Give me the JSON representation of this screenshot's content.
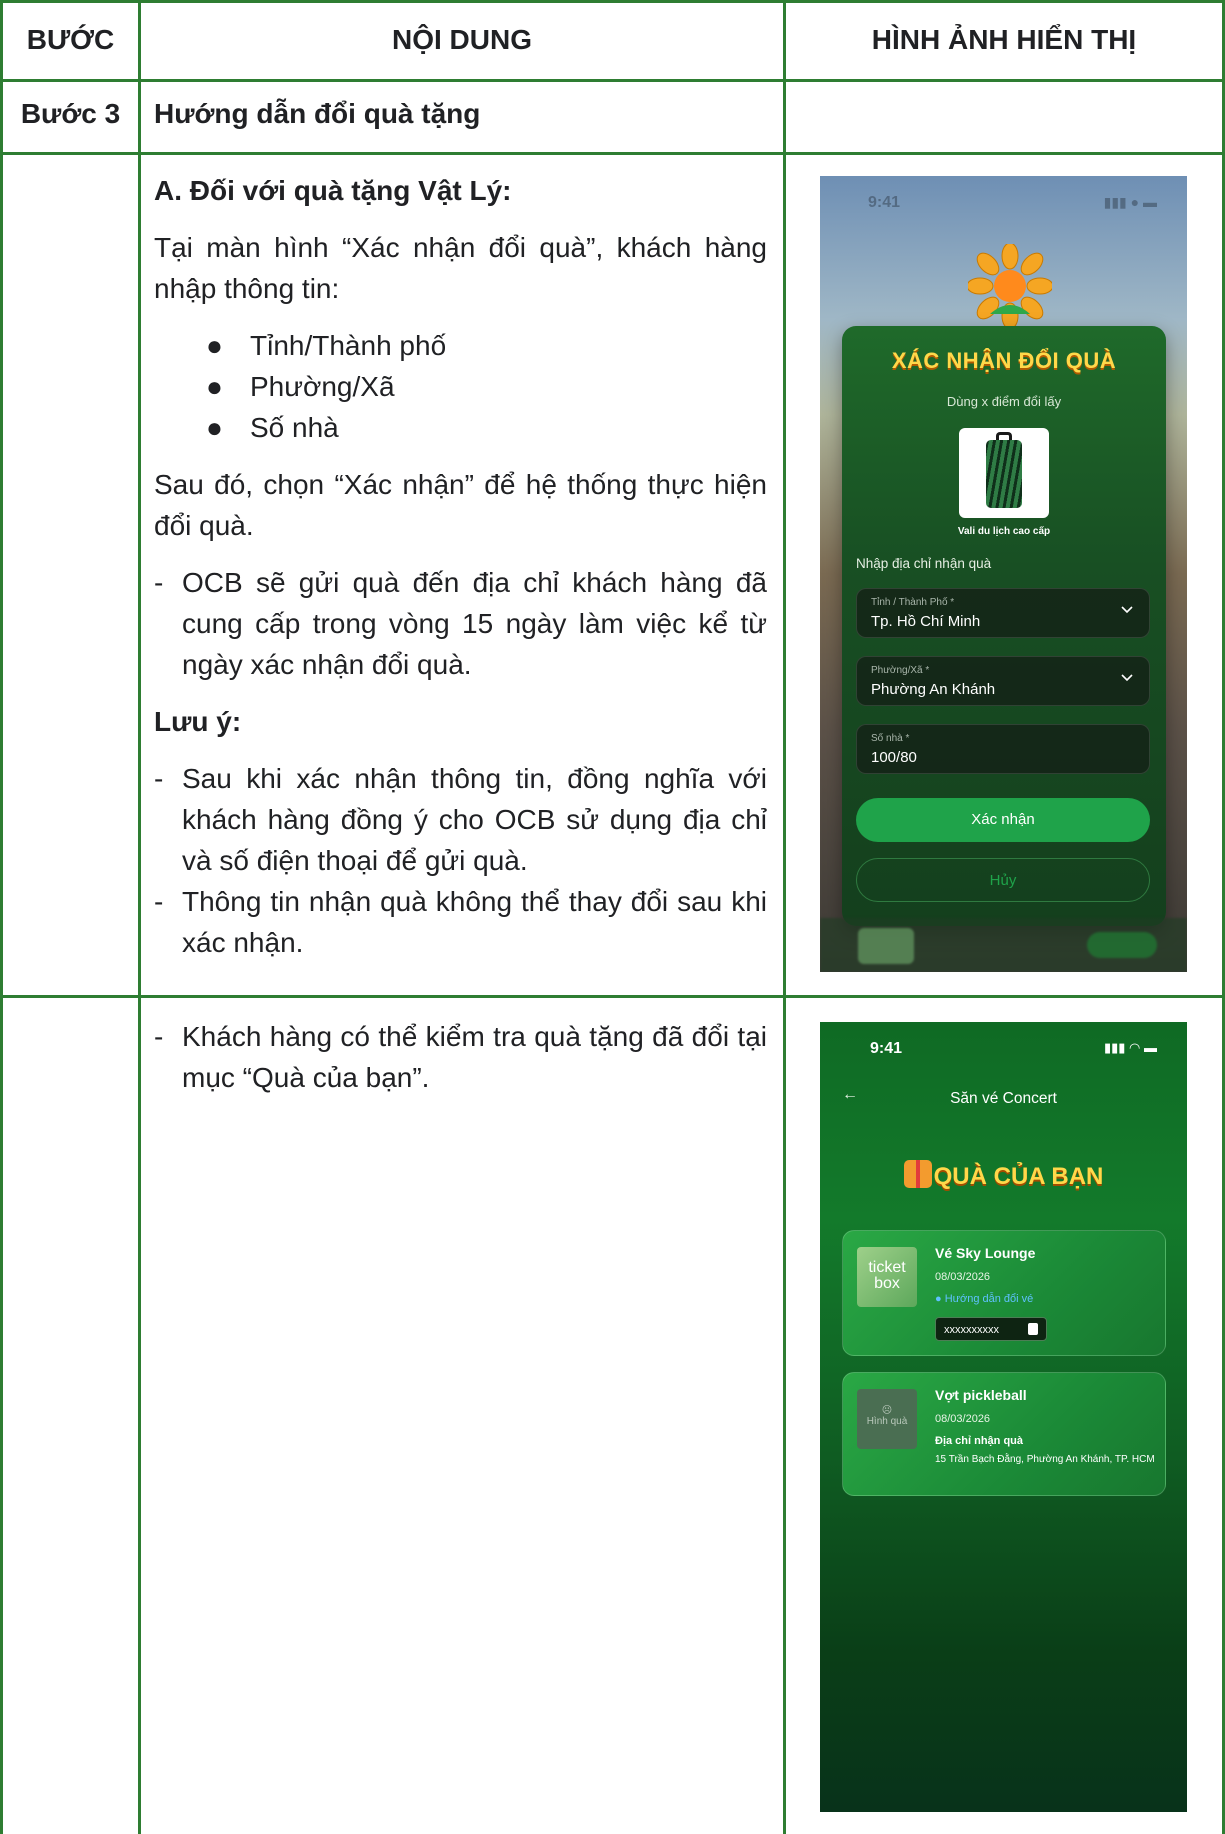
{
  "headers": {
    "step": "BƯỚC",
    "content": "NỘI DUNG",
    "display": "HÌNH ẢNH HIỂN THỊ"
  },
  "row_step3": {
    "step": "Bước 3",
    "title": "Hướng dẫn đổi quà tặng"
  },
  "section_a": {
    "heading": "A.  Đối với quà tặng Vật Lý:",
    "intro": "Tại màn hình “Xác nhận đổi quà”, khách hàng nhập thông tin:",
    "bullets": [
      "Tỉnh/Thành phố",
      "Phường/Xã",
      "Số nhà"
    ],
    "confirm_text": "Sau đó, chọn “Xác nhận” để hệ thống thực hiện đổi quà.",
    "delivery_note": "OCB sẽ gửi quà đến địa chỉ khách hàng đã cung cấp trong vòng 15 ngày làm việc kể từ ngày xác nhận đổi quà.",
    "note_heading": "Lưu ý:",
    "notes": [
      "Sau khi xác nhận thông tin, đồng nghĩa với khách hàng đồng ý cho OCB sử dụng địa chỉ và số điện thoại để gửi quà.",
      "Thông tin nhận quà không thể thay đổi sau khi xác nhận."
    ]
  },
  "row_check": {
    "text": "Khách hàng có thể kiểm tra quà tặng đã đổi tại mục “Quà của bạn”."
  },
  "dash": "-",
  "bullet_glyph": "●",
  "screen_confirm": {
    "time": "9:41",
    "title": "XÁC NHẬN ĐỔI QUÀ",
    "subtitle": "Dùng x điểm đổi lấy",
    "gift_name": "Vali du lịch cao cấp",
    "address_label": "Nhập địa chỉ nhận quà",
    "province": {
      "label": "Tỉnh / Thành Phố *",
      "value": "Tp. Hồ Chí Minh"
    },
    "ward": {
      "label": "Phường/Xã *",
      "value": "Phường An Khánh"
    },
    "house": {
      "label": "Số nhà *",
      "value": "100/80"
    },
    "confirm_button": "Xác nhận",
    "cancel_button": "Hủy"
  },
  "screen_gifts": {
    "time": "9:41",
    "back": "←",
    "title": "Săn vé Concert",
    "hero": "QUÀ CỦA BẠN",
    "cards": [
      {
        "thumb": "ticket box",
        "name": "Vé Sky Lounge",
        "date": "08/03/2026",
        "link": "Hướng dẫn đổi vé",
        "code": "xxxxxxxxxx"
      },
      {
        "thumb": "Hình quà",
        "name": "Vợt pickleball",
        "date": "08/03/2026",
        "address_label": "Địa chỉ nhận quà",
        "address": "15 Trần Bạch Đằng, Phường An Khánh, TP. HCM"
      }
    ]
  },
  "colors": {
    "border": "#2e7d32",
    "brand_green": "#1fa34a",
    "gold": "#ffd84a"
  }
}
